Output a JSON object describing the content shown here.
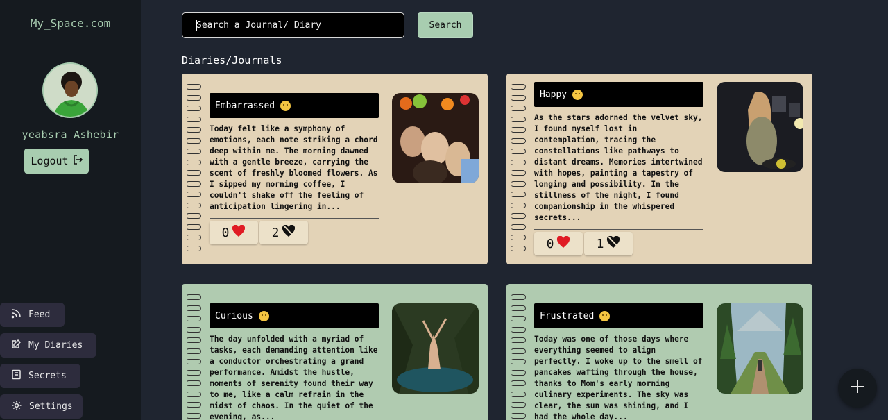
{
  "brand": "My_Space.com",
  "user": {
    "name": "yeabsra Ashebir"
  },
  "logout_label": "Logout",
  "nav": {
    "feed": "Feed",
    "my_diaries": "My Diaries",
    "secrets": "Secrets",
    "settings": "Settings"
  },
  "search": {
    "placeholder": "Search a Journal/ Diary",
    "button_label": "Search"
  },
  "section_title": "Diaries/Journals",
  "cards": [
    {
      "mood": "Embarrassed",
      "text": "Today felt like a symphony of emotions, each note striking a chord deep within me. The morning dawned with a gentle breeze, carrying the scent of freshly bloomed flowers. As I sipped my morning coffee, I couldn't shake off the feeling of anticipation lingering in...",
      "likes": "0",
      "dislikes": "2"
    },
    {
      "mood": "Happy",
      "text": "As the stars adorned the velvet sky, I found myself lost in contemplation, tracing the constellations like pathways to distant dreams. Memories intertwined with hopes, painting a tapestry of longing and possibility. In the stillness of the night, I found companionship in the whispered secrets...",
      "likes": "0",
      "dislikes": "1"
    },
    {
      "mood": "Curious",
      "text": "The day unfolded with a myriad of tasks, each demanding attention like a conductor orchestrating a grand performance. Amidst the hustle, moments of serenity found their way to me, like a calm refrain in the midst of chaos. In the quiet of the evening, as...",
      "likes": "",
      "dislikes": ""
    },
    {
      "mood": "Frustrated",
      "text": "Today was one of those days where everything seemed to align perfectly. I woke up to the smell of pancakes wafting through the house, thanks to Mom's early morning culinary experiments. The sky was clear, the sun was shining, and I had the whole day...",
      "likes": "",
      "dislikes": ""
    }
  ],
  "colors": {
    "accent": "#a8cdb0",
    "sidebar": "#151a1f",
    "background": "#1f2530",
    "card_beige": "#e3d3b7",
    "card_green": "#b0cbb0"
  },
  "icons": {
    "logout": "logout-icon",
    "feed": "rss-icon",
    "my_diaries": "edit-notebook-icon",
    "secrets": "notebook-icon",
    "settings": "gear-icon",
    "like": "heart-icon",
    "dislike": "broken-heart-icon",
    "add": "plus-icon"
  }
}
